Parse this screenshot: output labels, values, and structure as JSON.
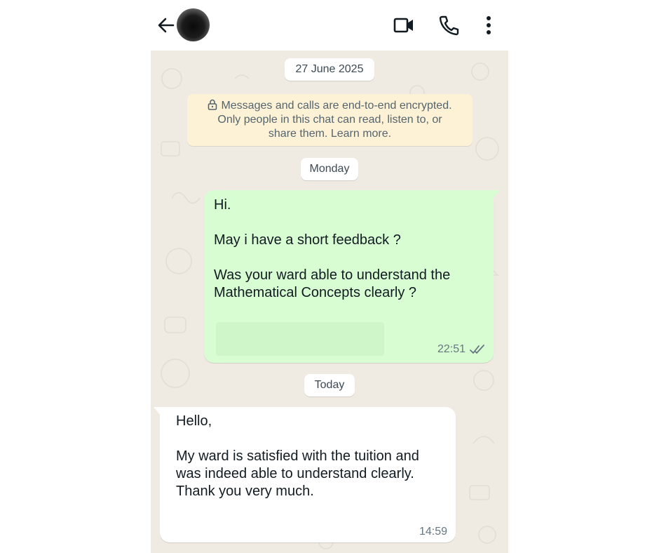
{
  "header": {
    "back_label": "Back",
    "contact_avatar": "contact-avatar",
    "icons": [
      "arrow-left-icon",
      "video-call-icon",
      "phone-icon",
      "more-vertical-icon"
    ]
  },
  "chat": {
    "date_pill": "27 June 2025",
    "encryption_notice": {
      "line1": "Messages and calls are end-to-end encrypted.",
      "line2": "Only people in this chat can read, listen to, or",
      "line3": "share them. Learn more.",
      "icon": "lock-icon"
    },
    "day_pill_1": "Monday",
    "outgoing": {
      "lines": [
        "Hi.",
        "May i have a short feedback ?",
        "Was your ward able to understand the",
        "Mathematical Concepts clearly ?"
      ],
      "time": "22:51",
      "status_icon": "double-check-icon"
    },
    "day_pill_2": "Today",
    "incoming": {
      "lines": [
        "Hello,",
        "My ward is satisfied with the tuition and",
        "was indeed able to understand clearly.",
        "Thank you very much."
      ],
      "time": "14:59"
    }
  },
  "colors": {
    "chat_background": "#efeae2",
    "outgoing_bubble": "#d9fdd3",
    "incoming_bubble": "#ffffff",
    "notice_background": "#fdf2d5",
    "read_ticks": "#667781"
  }
}
